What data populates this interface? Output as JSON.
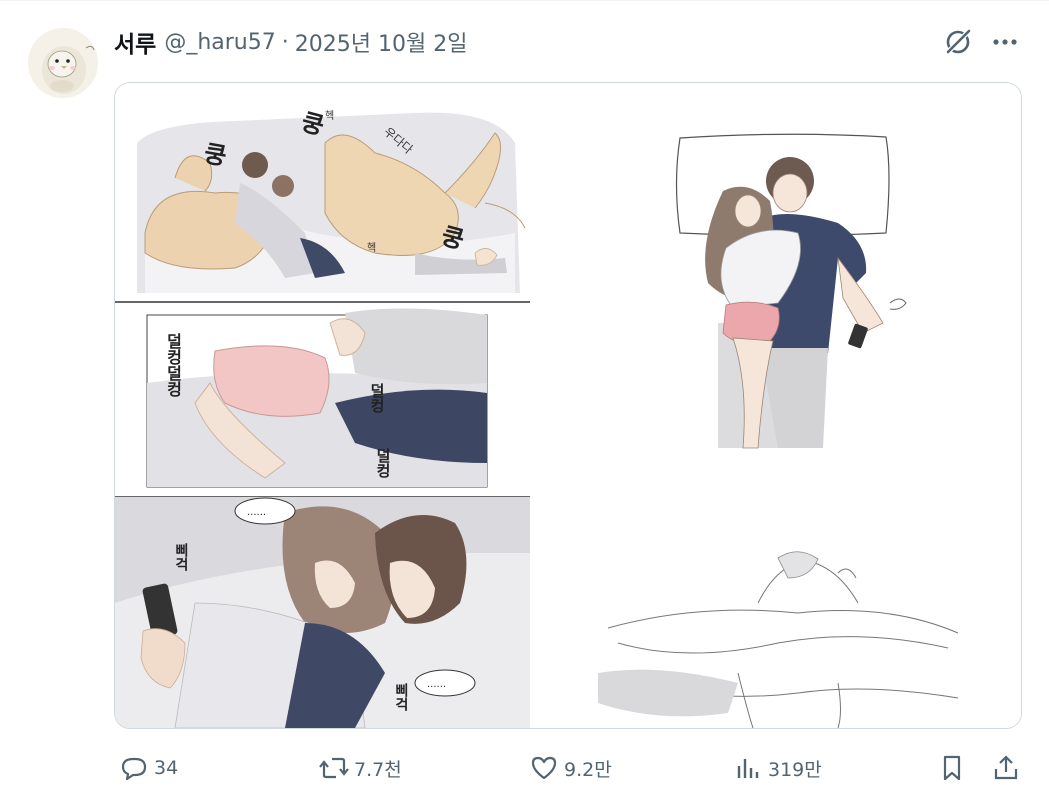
{
  "author": {
    "name": "서루",
    "handle": "@_haru57",
    "separator": "·",
    "date": "2025년 10월 2일"
  },
  "icons": {
    "grok": "grok-icon",
    "more": "more-icon",
    "reply": "reply-icon",
    "retweet": "retweet-icon",
    "like": "heart-icon",
    "views": "views-icon",
    "bookmark": "bookmark-icon",
    "share": "share-icon"
  },
  "media": {
    "left_panel_sfx": {
      "thump_1": "쿵",
      "thump_2": "쿵",
      "thump_3": "쿵",
      "rumble": "우다다",
      "pant_1": "헥",
      "pant_2": "헥",
      "bounce": "덜컹덜컹",
      "bounce_2": "덜컹",
      "bounce_3": "덜컹",
      "ellipsis_1": "......",
      "ellipsis_2": "......",
      "squeak_1": "삐걱",
      "squeak_2": "삐걱"
    }
  },
  "engagement": {
    "replies": "34",
    "retweets": "7.7천",
    "likes": "9.2만",
    "views": "319만"
  },
  "colors": {
    "text_primary": "#0f1419",
    "text_secondary": "#536471",
    "border": "#cfd9de"
  }
}
